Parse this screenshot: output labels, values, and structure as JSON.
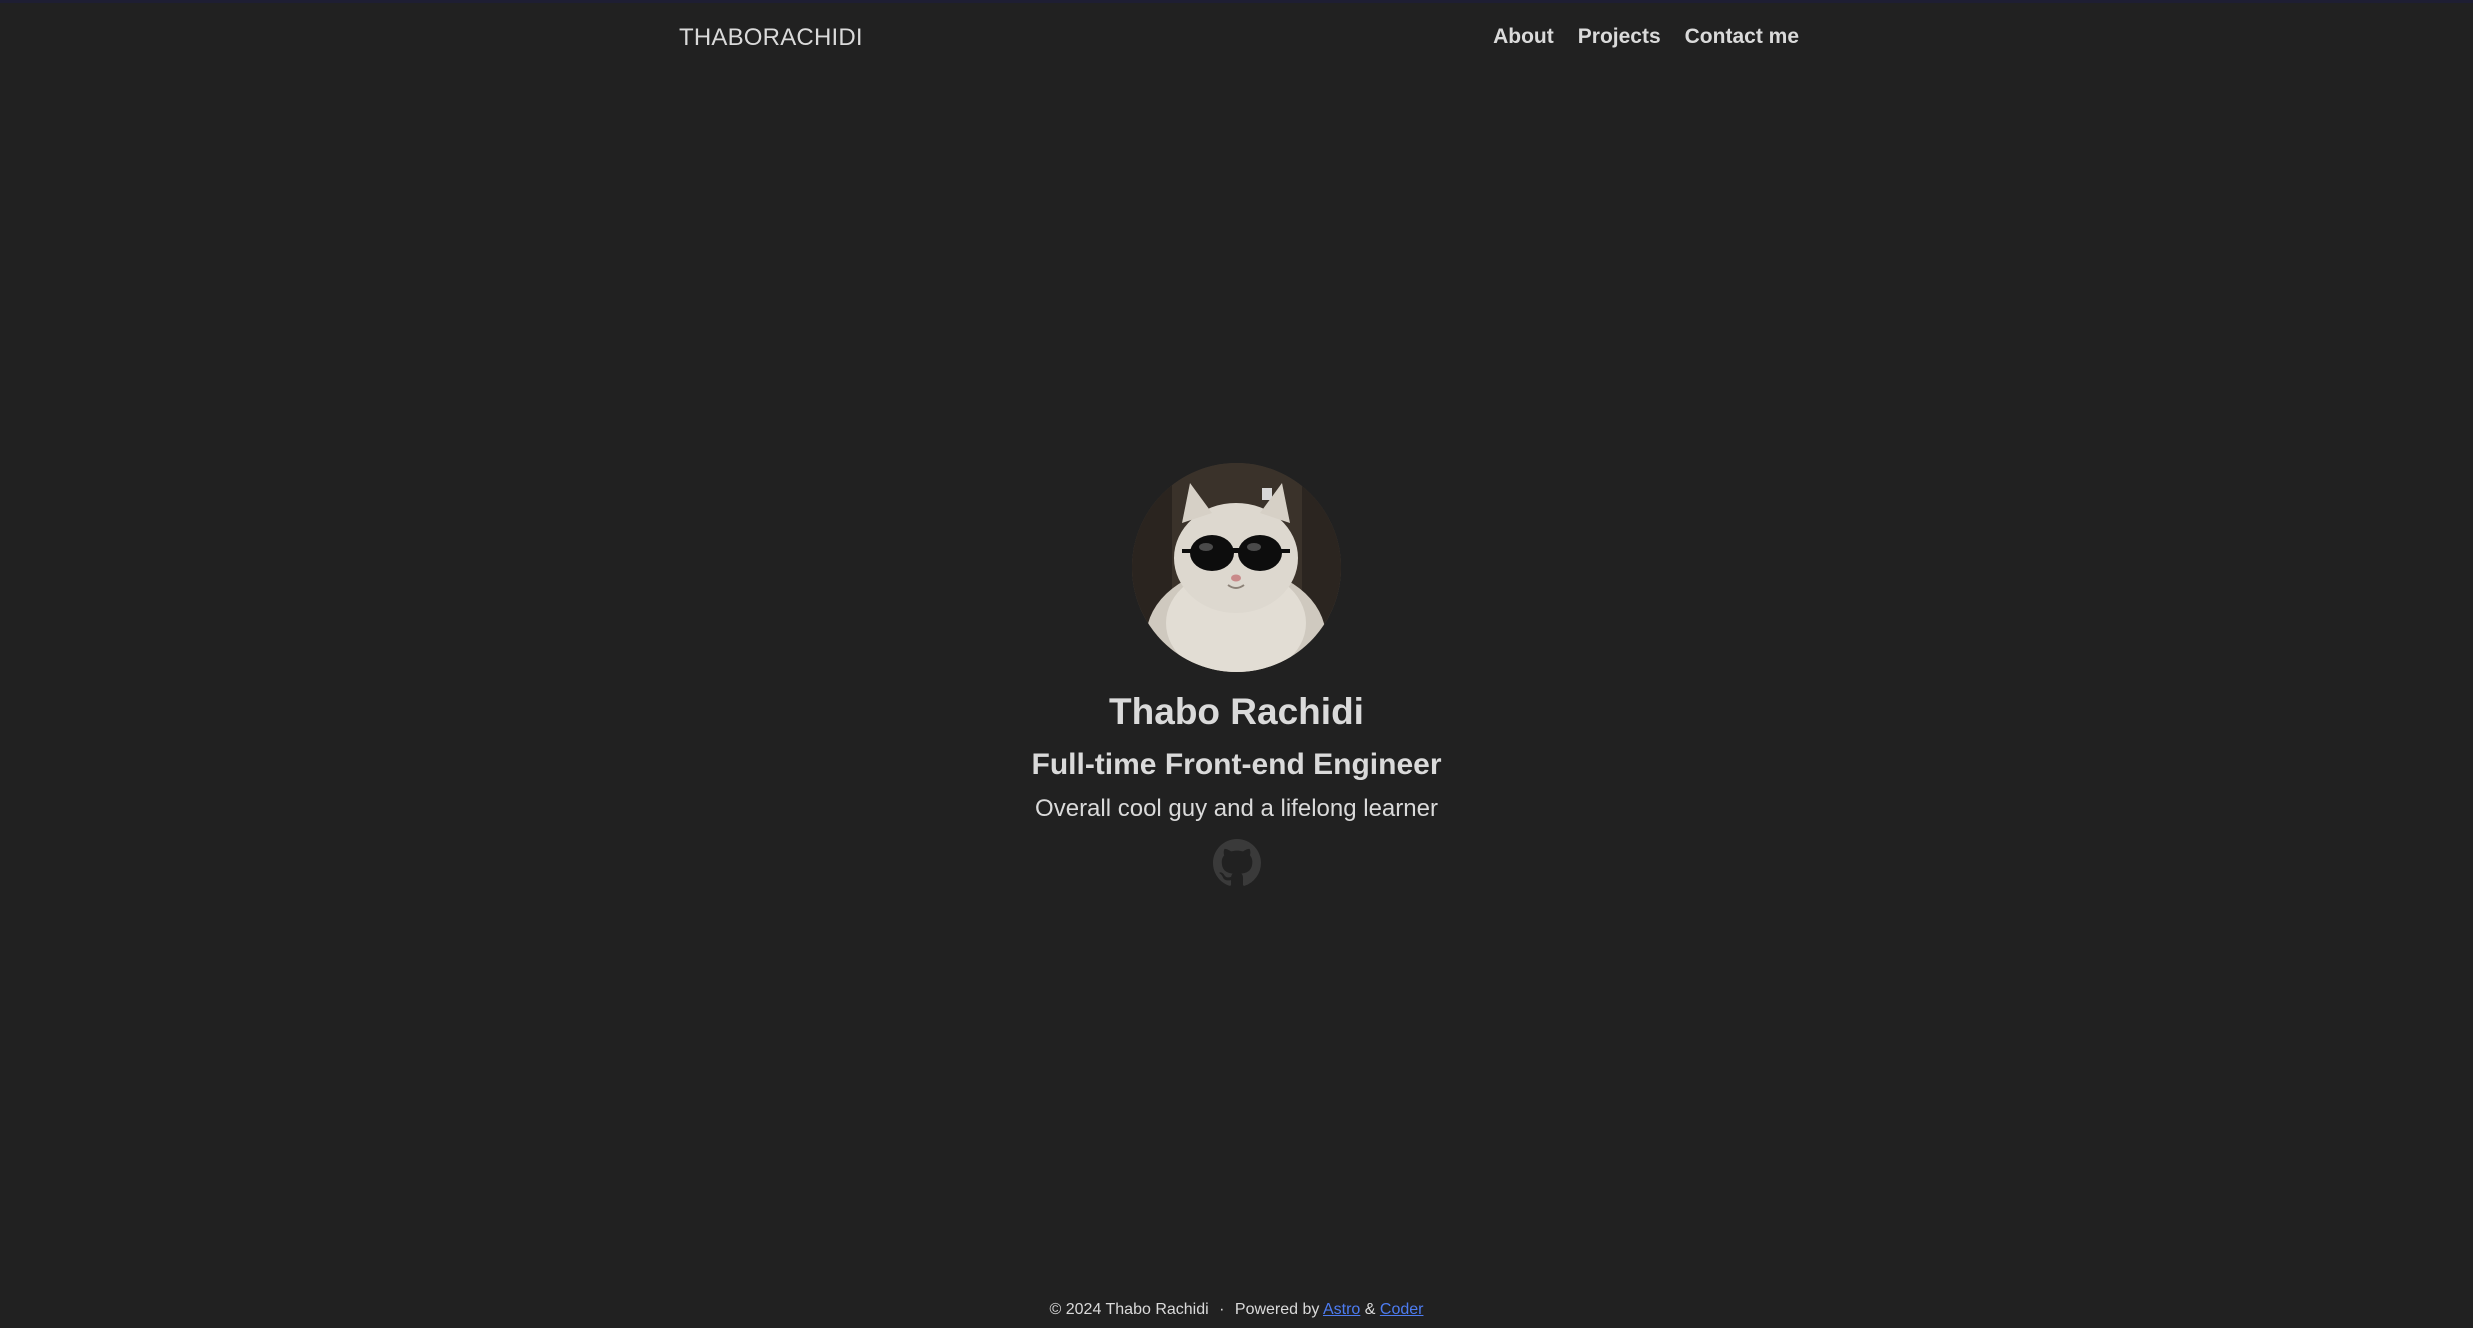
{
  "nav": {
    "brand": "THABORACHIDI",
    "items": [
      {
        "label": "About"
      },
      {
        "label": "Projects"
      },
      {
        "label": "Contact me"
      }
    ]
  },
  "hero": {
    "avatar_icon": "avatar-cat-sunglasses",
    "name": "Thabo Rachidi",
    "title": "Full-time Front-end Engineer",
    "tagline": "Overall cool guy and a lifelong learner",
    "social_icon": "github-icon"
  },
  "footer": {
    "copyright": "© 2024 Thabo Rachidi",
    "separator": "·",
    "powered_by": "Powered by",
    "link1": "Astro",
    "ampersand": "&",
    "link2": "Coder"
  },
  "colors": {
    "background": "#212121",
    "text": "#dadada",
    "link": "#4d7cf1"
  }
}
